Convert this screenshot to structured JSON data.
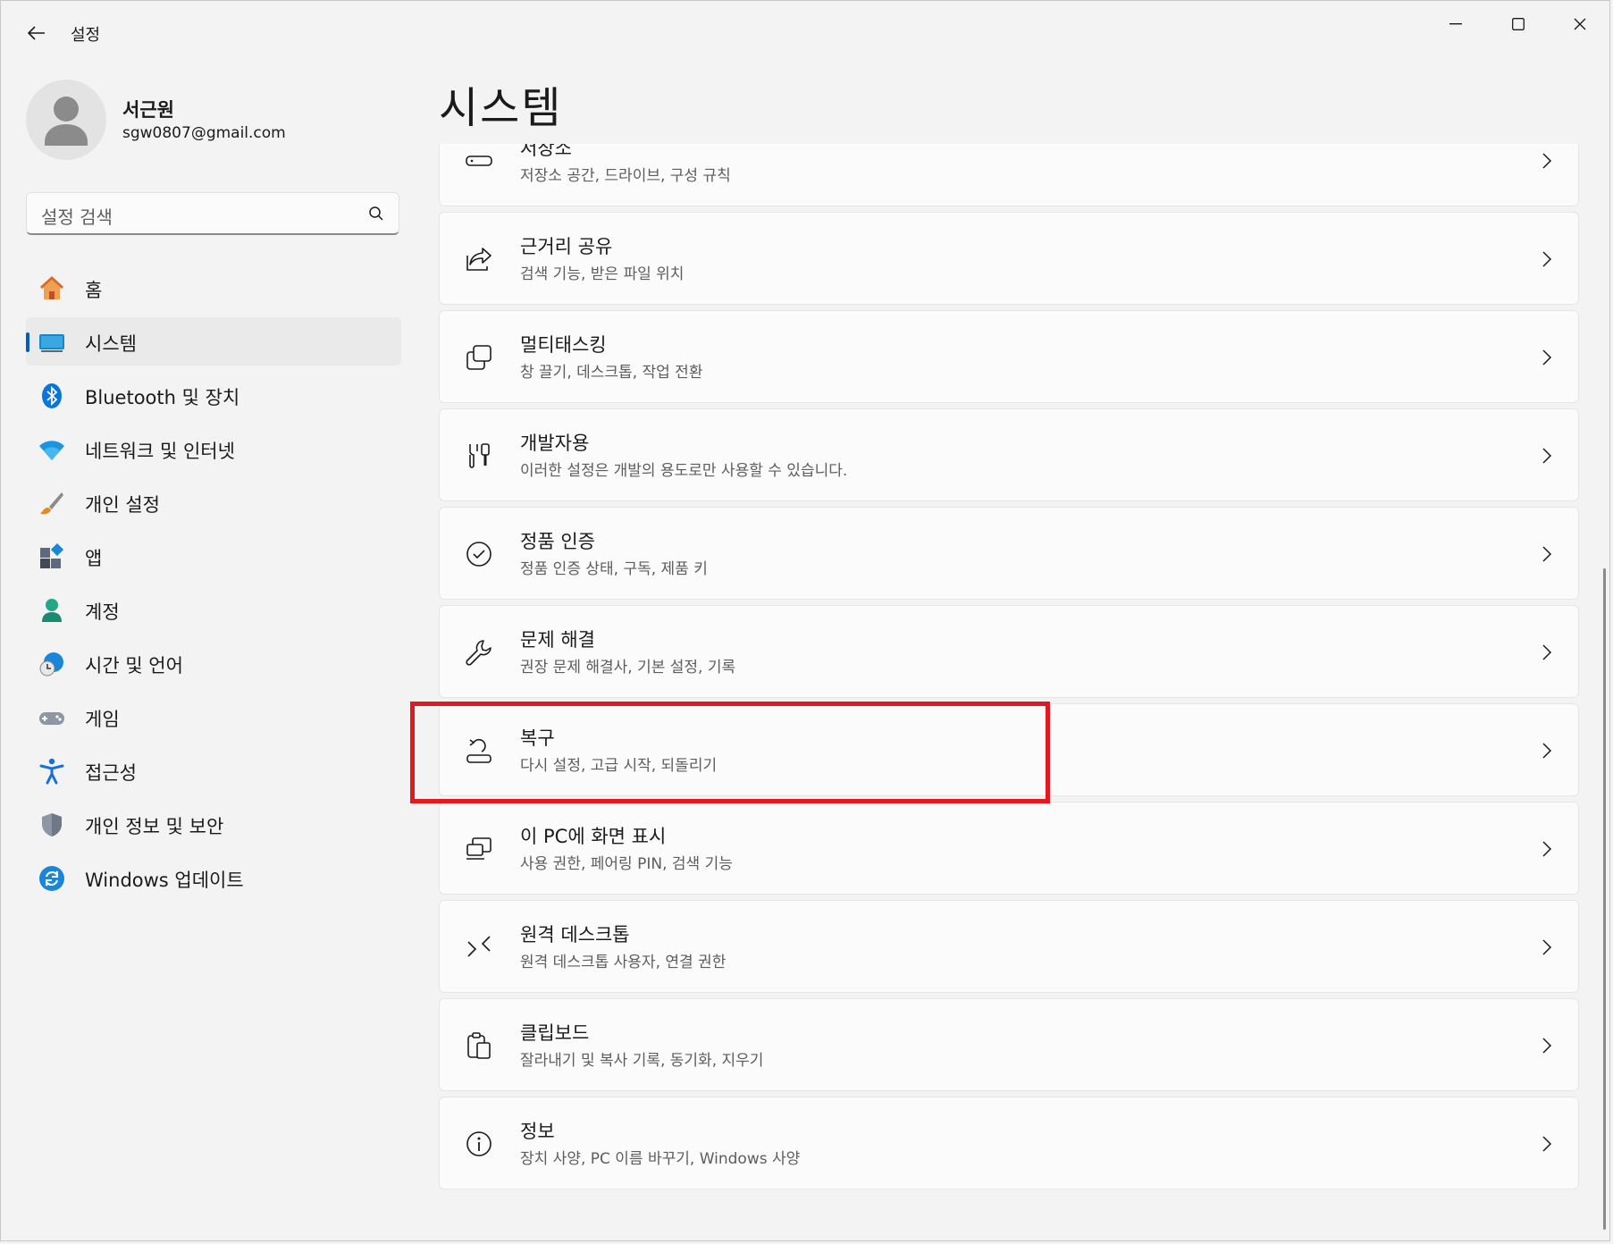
{
  "window": {
    "title": "설정"
  },
  "profile": {
    "name": "서근원",
    "email": "sgw0807@gmail.com"
  },
  "search": {
    "placeholder": "설정 검색"
  },
  "nav": [
    {
      "label": "홈",
      "icon": "home-icon"
    },
    {
      "label": "시스템",
      "icon": "system-icon",
      "active": true
    },
    {
      "label": "Bluetooth 및 장치",
      "icon": "bluetooth-icon"
    },
    {
      "label": "네트워크 및 인터넷",
      "icon": "wifi-icon"
    },
    {
      "label": "개인 설정",
      "icon": "brush-icon"
    },
    {
      "label": "앱",
      "icon": "apps-icon"
    },
    {
      "label": "계정",
      "icon": "account-icon"
    },
    {
      "label": "시간 및 언어",
      "icon": "globe-clock-icon"
    },
    {
      "label": "게임",
      "icon": "gamepad-icon"
    },
    {
      "label": "접근성",
      "icon": "accessibility-icon"
    },
    {
      "label": "개인 정보 및 보안",
      "icon": "shield-icon"
    },
    {
      "label": "Windows 업데이트",
      "icon": "update-icon"
    }
  ],
  "main": {
    "title": "시스템",
    "items": [
      {
        "title": "저장소",
        "desc": "저장소 공간, 드라이브, 구성 규칙",
        "icon": "storage-icon"
      },
      {
        "title": "근거리 공유",
        "desc": "검색 기능, 받은 파일 위치",
        "icon": "share-icon"
      },
      {
        "title": "멀티태스킹",
        "desc": "창 끌기, 데스크톱, 작업 전환",
        "icon": "multitasking-icon"
      },
      {
        "title": "개발자용",
        "desc": "이러한 설정은 개발의 용도로만 사용할 수 있습니다.",
        "icon": "developer-tools-icon"
      },
      {
        "title": "정품 인증",
        "desc": "정품 인증 상태, 구독, 제품 키",
        "icon": "check-circle-icon"
      },
      {
        "title": "문제 해결",
        "desc": "권장 문제 해결사, 기본 설정, 기록",
        "icon": "wrench-icon"
      },
      {
        "title": "복구",
        "desc": "다시 설정, 고급 시작, 되돌리기",
        "icon": "recovery-icon",
        "highlighted": true
      },
      {
        "title": "이 PC에 화면 표시",
        "desc": "사용 권한, 페어링 PIN, 검색 기능",
        "icon": "project-to-pc-icon"
      },
      {
        "title": "원격 데스크톱",
        "desc": "원격 데스크톱 사용자, 연결 권한",
        "icon": "remote-desktop-icon"
      },
      {
        "title": "클립보드",
        "desc": "잘라내기 및 복사 기록, 동기화, 지우기",
        "icon": "clipboard-icon"
      },
      {
        "title": "정보",
        "desc": "장치 사양, PC 이름 바꾸기, Windows 사양",
        "icon": "info-icon"
      }
    ]
  },
  "colors": {
    "accent": "#005fb8",
    "highlight": "#e11a22",
    "background": "#f3f3f3",
    "card": "#fbfbfb"
  }
}
